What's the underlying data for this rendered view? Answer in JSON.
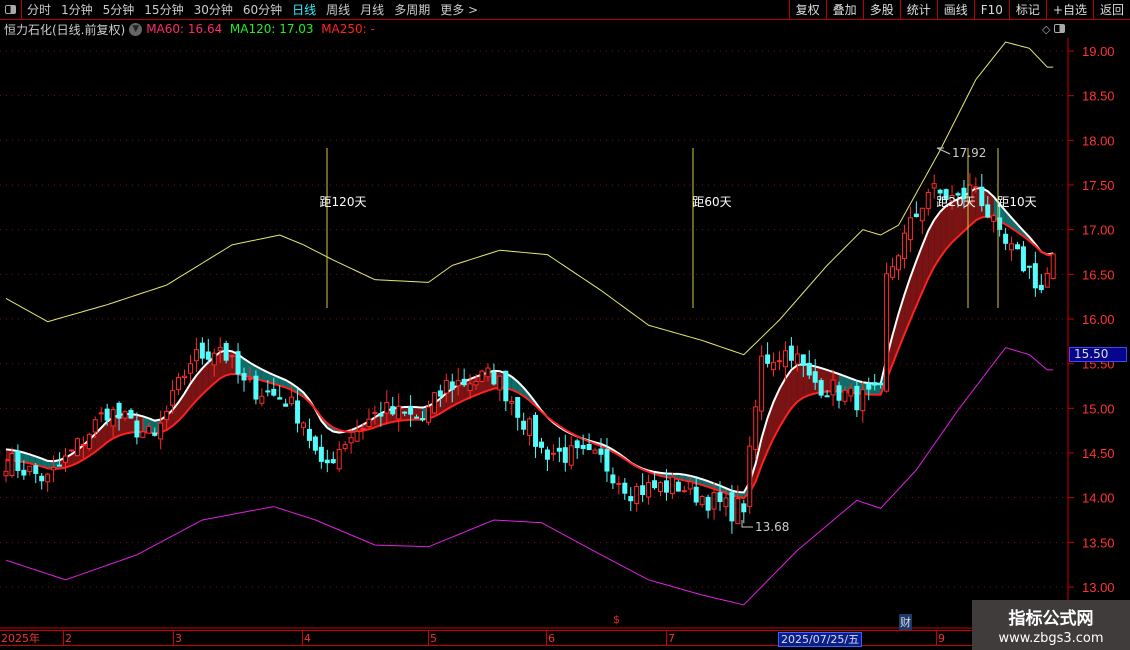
{
  "toolbar": {
    "periods": [
      "分时",
      "1分钟",
      "5分钟",
      "15分钟",
      "30分钟",
      "60分钟",
      "日线",
      "周线",
      "月线",
      "多周期",
      "更多 >"
    ],
    "active_period": "日线",
    "right_buttons": [
      "复权",
      "叠加",
      "多股",
      "统计",
      "画线",
      "F10",
      "标记",
      "+自选",
      "返回"
    ]
  },
  "info": {
    "title": "恒力石化(日线.前复权)",
    "ma60_label": "MA60: 16.64",
    "ma120_label": "MA120: 17.03",
    "ma250_label": "MA250: -",
    "ma60_color": "#ff2a6a",
    "ma120_color": "#22ee22",
    "ma250_color": "#ff2222"
  },
  "price_axis": {
    "ticks": [
      "19.00",
      "18.50",
      "18.00",
      "17.50",
      "17.00",
      "16.50",
      "16.00",
      "15.50",
      "15.00",
      "14.50",
      "14.00",
      "13.50",
      "13.00"
    ],
    "range": [
      12.8,
      19.15
    ],
    "last_price": "15.50"
  },
  "date_axis": {
    "labels": [
      "2025年",
      "2",
      "3",
      "4",
      "5",
      "6",
      "7",
      "9"
    ],
    "selected_date": "2025/07/25/五"
  },
  "annotations": {
    "high": "17.92",
    "low": "13.68",
    "markers": [
      "距120天",
      "距60天",
      "距20天",
      "距10天"
    ],
    "s_mark": "$",
    "cai_mark": "财"
  },
  "watermark": {
    "line1": "指标公式网",
    "line2": "www.zbgs3.com"
  },
  "colors": {
    "up": "#ff2a2a",
    "down": "#54fcfc",
    "upper_band": "#e8e870",
    "lower_band": "#e020e0",
    "fast_line": "#ffffff",
    "slow_line": "#ff2020",
    "bull_fill": "#7a1414",
    "bear_fill": "#0f6e6a"
  },
  "chart_data": {
    "type": "candlestick",
    "close_path": [
      [
        0,
        14.42
      ],
      [
        7,
        14.2
      ],
      [
        10,
        14.42
      ],
      [
        17,
        14.98
      ],
      [
        25,
        14.65
      ],
      [
        31,
        15.54
      ],
      [
        36,
        15.7
      ],
      [
        40,
        15.26
      ],
      [
        47,
        15.1
      ],
      [
        50,
        14.87
      ],
      [
        53,
        14.3
      ],
      [
        57,
        14.65
      ],
      [
        63,
        14.98
      ],
      [
        70,
        14.87
      ],
      [
        74,
        15.26
      ],
      [
        82,
        15.37
      ],
      [
        85,
        15.1
      ],
      [
        90,
        14.53
      ],
      [
        100,
        14.42
      ],
      [
        105,
        14.09
      ],
      [
        113,
        14.14
      ],
      [
        122,
        13.86
      ],
      [
        124,
        13.92
      ],
      [
        127,
        15.54
      ],
      [
        132,
        15.65
      ],
      [
        135,
        15.32
      ],
      [
        143,
        15.1
      ],
      [
        147,
        15.15
      ],
      [
        148,
        16.44
      ],
      [
        150,
        16.77
      ],
      [
        155,
        17.44
      ],
      [
        160,
        17.33
      ],
      [
        163,
        17.5
      ],
      [
        167,
        16.88
      ],
      [
        172,
        16.55
      ],
      [
        174,
        16.33
      ],
      [
        176,
        16.66
      ]
    ],
    "upper_band": [
      [
        0,
        16.23
      ],
      [
        7,
        15.97
      ],
      [
        17,
        16.16
      ],
      [
        27,
        16.38
      ],
      [
        38,
        16.83
      ],
      [
        46,
        16.94
      ],
      [
        50,
        16.83
      ],
      [
        55,
        16.66
      ],
      [
        62,
        16.44
      ],
      [
        71,
        16.41
      ],
      [
        75,
        16.6
      ],
      [
        83,
        16.77
      ],
      [
        91,
        16.72
      ],
      [
        100,
        16.32
      ],
      [
        108,
        15.93
      ],
      [
        117,
        15.76
      ],
      [
        124,
        15.6
      ],
      [
        130,
        15.99
      ],
      [
        138,
        16.6
      ],
      [
        144,
        17.0
      ],
      [
        147,
        16.94
      ],
      [
        150,
        17.05
      ],
      [
        157,
        17.89
      ],
      [
        163,
        18.68
      ],
      [
        168,
        19.1
      ],
      [
        172,
        19.03
      ],
      [
        175,
        18.82
      ]
    ],
    "lower_band": [
      [
        0,
        13.3
      ],
      [
        10,
        13.08
      ],
      [
        22,
        13.36
      ],
      [
        33,
        13.75
      ],
      [
        45,
        13.9
      ],
      [
        52,
        13.75
      ],
      [
        62,
        13.47
      ],
      [
        71,
        13.45
      ],
      [
        82,
        13.75
      ],
      [
        90,
        13.72
      ],
      [
        100,
        13.36
      ],
      [
        108,
        13.08
      ],
      [
        117,
        12.91
      ],
      [
        124,
        12.8
      ],
      [
        133,
        13.41
      ],
      [
        143,
        13.97
      ],
      [
        147,
        13.88
      ],
      [
        153,
        14.31
      ],
      [
        160,
        14.98
      ],
      [
        168,
        15.68
      ],
      [
        172,
        15.6
      ],
      [
        175,
        15.43
      ]
    ],
    "high_value": 17.92,
    "low_value": 13.68
  }
}
